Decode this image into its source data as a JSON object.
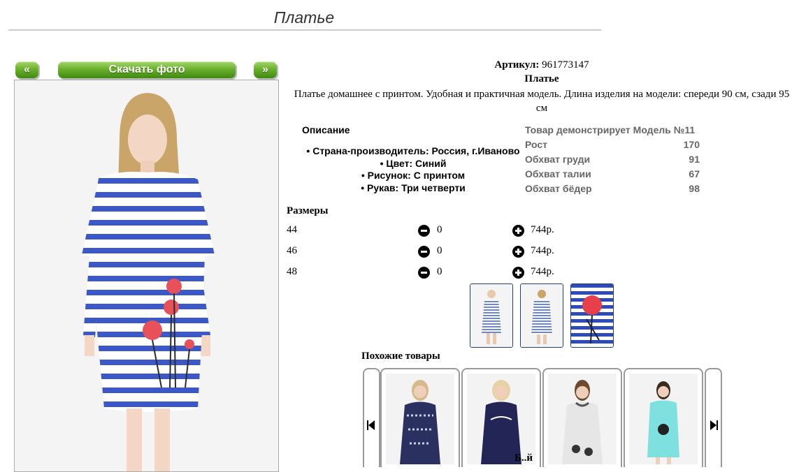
{
  "page": {
    "title": "Платье"
  },
  "gallery": {
    "prev_label": "«",
    "download_label": "Скачать фото",
    "next_label": "»"
  },
  "product": {
    "article_label": "Артикул:",
    "article_value": "961773147",
    "name": "Платье",
    "description": "Платье домашнее с принтом. Удобная и практичная модель. Длина изделия на модели: спереди 90 см, сзади 95 см"
  },
  "details": {
    "heading": "Описание",
    "items": [
      "Страна-производитель: Россия, г.Иваново",
      "Цвет: Синий",
      "Рисунок: С принтом",
      "Рукав: Три четверти"
    ]
  },
  "model": {
    "rows": [
      {
        "label": "Товар демонстрирует Модель №11",
        "value": ""
      },
      {
        "label": "Рост",
        "value": "170"
      },
      {
        "label": "Обхват груди",
        "value": "91"
      },
      {
        "label": "Обхват талии",
        "value": "67"
      },
      {
        "label": "Обхват бёдер",
        "value": "98"
      }
    ]
  },
  "sizes": {
    "heading": "Размеры",
    "rows": [
      {
        "size": "44",
        "qty": "0",
        "price": "744р."
      },
      {
        "size": "46",
        "qty": "0",
        "price": "744р."
      },
      {
        "size": "48",
        "qty": "0",
        "price": "744р."
      }
    ]
  },
  "similar": {
    "heading": "Похожие товары"
  },
  "footer": {
    "partial_text": "Б..й"
  },
  "icons": {
    "minus": "minus-circle-icon",
    "plus": "plus-circle-icon",
    "prev": "skip-back-icon",
    "next": "skip-forward-icon"
  },
  "colors": {
    "button_green": "#6ab12c",
    "stripe_blue": "#3c58c8",
    "poppy_red": "#e8505a"
  }
}
